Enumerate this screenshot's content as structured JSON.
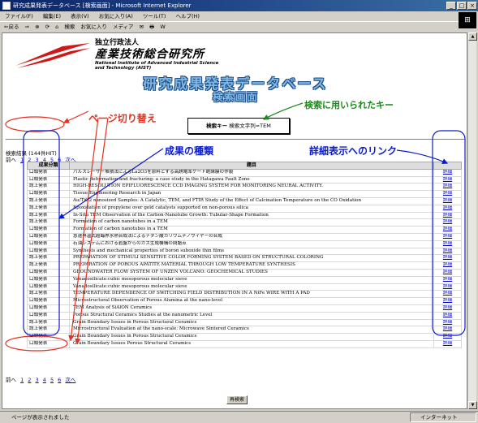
{
  "window": {
    "title": "研究成果発表データベース [検索画面] - Microsoft Internet Explorer"
  },
  "menubar": {
    "items": [
      "ファイル(F)",
      "編集(E)",
      "表示(V)",
      "お気に入り(A)",
      "ツール(T)",
      "ヘルプ(H)"
    ]
  },
  "toolbar": {
    "items": [
      "⇐戻る",
      "⇒",
      "⊗",
      "⟳",
      "⌂",
      "検索",
      "お気に入り",
      "メディア",
      "✉",
      "🖶",
      "W"
    ]
  },
  "header": {
    "institute": "独立行政法人",
    "name": "産業技術総合研究所",
    "english": "National Institute of Advanced Industrial Science and Technology (AIST)",
    "title": "研究成果発表データベース",
    "subtitle": "検索画面"
  },
  "search": {
    "label": "検索キー",
    "condition": "検索文字列=TEM"
  },
  "annotations": {
    "page_switch": "ページ切り替え",
    "search_key": "検索に用いられたキー",
    "kind": "成果の種類",
    "detail_link": "詳細表示へのリンク"
  },
  "result_count": "検索結果 (144件HIT)",
  "pager": {
    "prev": "前へ",
    "pages": [
      "1",
      "2",
      "3",
      "4",
      "5",
      "6"
    ],
    "next": "次へ"
  },
  "table": {
    "headers": [
      "成果分類",
      "題目",
      ""
    ],
    "detail_label": "詳細",
    "rows": [
      {
        "kind": "口頭発表",
        "title": "パルスレーザー堆積法によるLa2O3を原料とする高誘電率ゲート絶縁膜の作製"
      },
      {
        "kind": "口頭発表",
        "title": "Plastic deformation and fracturing: a case study in the Hatagawa Fault Zone"
      },
      {
        "kind": "誌上発表",
        "title": "HIGH-RESOLUTION EPIFLUORESCENCE CCD IMAGING SYSTEM FOR MONITORING NEURAL ACTIVITY."
      },
      {
        "kind": "口頭発表",
        "title": "Tissue Engineering Research in Japan"
      },
      {
        "kind": "誌上発表",
        "title": "Au/TiO2 nanosized Samples: A Catalytic, TEM, and FTIR Study of the Effect of Calcination Temperature on the CO Oxidation"
      },
      {
        "kind": "誌上発表",
        "title": "Epoxidation of propylene over gold catalysts supported on non-porous silica"
      },
      {
        "kind": "誌上発表",
        "title": "In-Situ TEM Observation of the Carbon-Nanotube Growth: Tubular-Shape Formation"
      },
      {
        "kind": "誌上発表",
        "title": "Formation of carbon nanotubes in a TEM"
      },
      {
        "kind": "口頭発表",
        "title": "Formation of carbon nanotubes in a TEM"
      },
      {
        "kind": "口頭発表",
        "title": "急速昇温式超臨界水熱合成法によるチタン酸カリウムナノワイヤーの合成"
      },
      {
        "kind": "口頭発表",
        "title": "石油システムにおける岩盤からのガス生成機構の問題点"
      },
      {
        "kind": "口頭発表",
        "title": "Synthesis and mechanical properties of boron suboxide thin films"
      },
      {
        "kind": "誌上発表",
        "title": "PREPARATION OF STIMULI SENSITIVE COLOR FORMING SYSTEM BASED ON STRUCTURAL COLORING"
      },
      {
        "kind": "誌上発表",
        "title": "PREPARATION OF POROUS APATITE MATERIAL THROUGH LOW TEMPERATURE SYNTHESIS"
      },
      {
        "kind": "口頭発表",
        "title": "GROUNDWATER FLOW SYSTEM OF UNZEN VOLCANO: GEOCHEMICAL STUDIES"
      },
      {
        "kind": "口頭発表",
        "title": "Vanadosilicate:cubic mesoporous molecular sieve"
      },
      {
        "kind": "口頭発表",
        "title": "Vanadosilicate:cubic mesoporous molecular sieve"
      },
      {
        "kind": "誌上発表",
        "title": "TEMPERATURE DEPENDENCE OF SWITCHING FIELD DISTRIBUTION IN A NiFe WIRE WITH A PAD"
      },
      {
        "kind": "口頭発表",
        "title": "Microstructural Observation of Porous Alumina at the nano-level"
      },
      {
        "kind": "口頭発表",
        "title": "TEM Analysis of SiAlON Ceramics"
      },
      {
        "kind": "口頭発表",
        "title": "Porous Structural Ceramics Studies at the nanometric Level"
      },
      {
        "kind": "誌上発表",
        "title": "Grain Boundary Issues in Porous Structural Ceramics"
      },
      {
        "kind": "誌上発表",
        "title": "Microstructural Evaluation at the nano-scale: Microwave Sintered Ceramics"
      },
      {
        "kind": "口頭発表",
        "title": "Grain Boundary Issues in Porous Structural Ceramics"
      },
      {
        "kind": "口頭発表",
        "title": "Grain Boundary Issues Porous Structural Ceramics"
      }
    ]
  },
  "research_button": "再検索",
  "status": {
    "left": "ページが表示されました",
    "zone": "インターネット"
  },
  "colors": {
    "annotation_red": "#e83020",
    "annotation_blue": "#0a1acc",
    "annotation_green": "#1a8a1a",
    "title_blue": "#7fb6e4"
  }
}
